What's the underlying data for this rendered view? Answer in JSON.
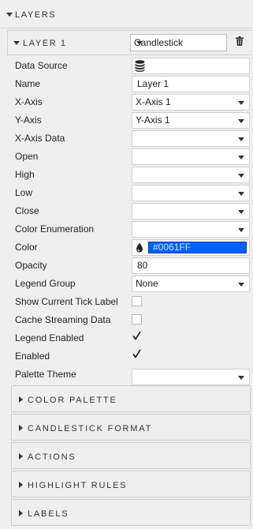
{
  "layers": {
    "title": "LAYERS"
  },
  "layer": {
    "title": "LAYER 1",
    "type_value": "Candlestick"
  },
  "fields": {
    "data_source": "Data Source",
    "name": {
      "label": "Name",
      "value": "Layer 1"
    },
    "x_axis": {
      "label": "X-Axis",
      "value": "X-Axis 1"
    },
    "y_axis": {
      "label": "Y-Axis",
      "value": "Y-Axis 1"
    },
    "x_axis_data": {
      "label": "X-Axis Data",
      "value": ""
    },
    "open": {
      "label": "Open",
      "value": ""
    },
    "high": {
      "label": "High",
      "value": ""
    },
    "low": {
      "label": "Low",
      "value": ""
    },
    "close": {
      "label": "Close",
      "value": ""
    },
    "color_enumeration": {
      "label": "Color Enumeration",
      "value": ""
    },
    "color": {
      "label": "Color",
      "value": "#0061FF"
    },
    "opacity": {
      "label": "Opacity",
      "value": "80"
    },
    "legend_group": {
      "label": "Legend Group",
      "value": "None"
    },
    "show_current_tick_label": {
      "label": "Show Current Tick Label",
      "checked": false
    },
    "cache_streaming_data": {
      "label": "Cache Streaming Data",
      "checked": false
    },
    "legend_enabled": {
      "label": "Legend Enabled",
      "checked": true
    },
    "enabled": {
      "label": "Enabled",
      "checked": true
    },
    "palette_theme": {
      "label": "Palette Theme",
      "value": ""
    }
  },
  "sections": {
    "color_palette": "COLOR PALETTE",
    "candlestick_format": "CANDLESTICK FORMAT",
    "actions": "ACTIONS",
    "highlight_rules": "HIGHLIGHT RULES",
    "labels": "LABELS"
  },
  "colors": {
    "panel_bg": "#efefef",
    "swatch_color": "#0061FF"
  },
  "icons": {
    "layers_caret": "chevron-down-icon",
    "trash": "trash-icon",
    "data_source": "database-icon",
    "color_picker": "ink-drop-icon",
    "checkmark": "checkmark-icon",
    "section_caret": "chevron-right-icon"
  }
}
